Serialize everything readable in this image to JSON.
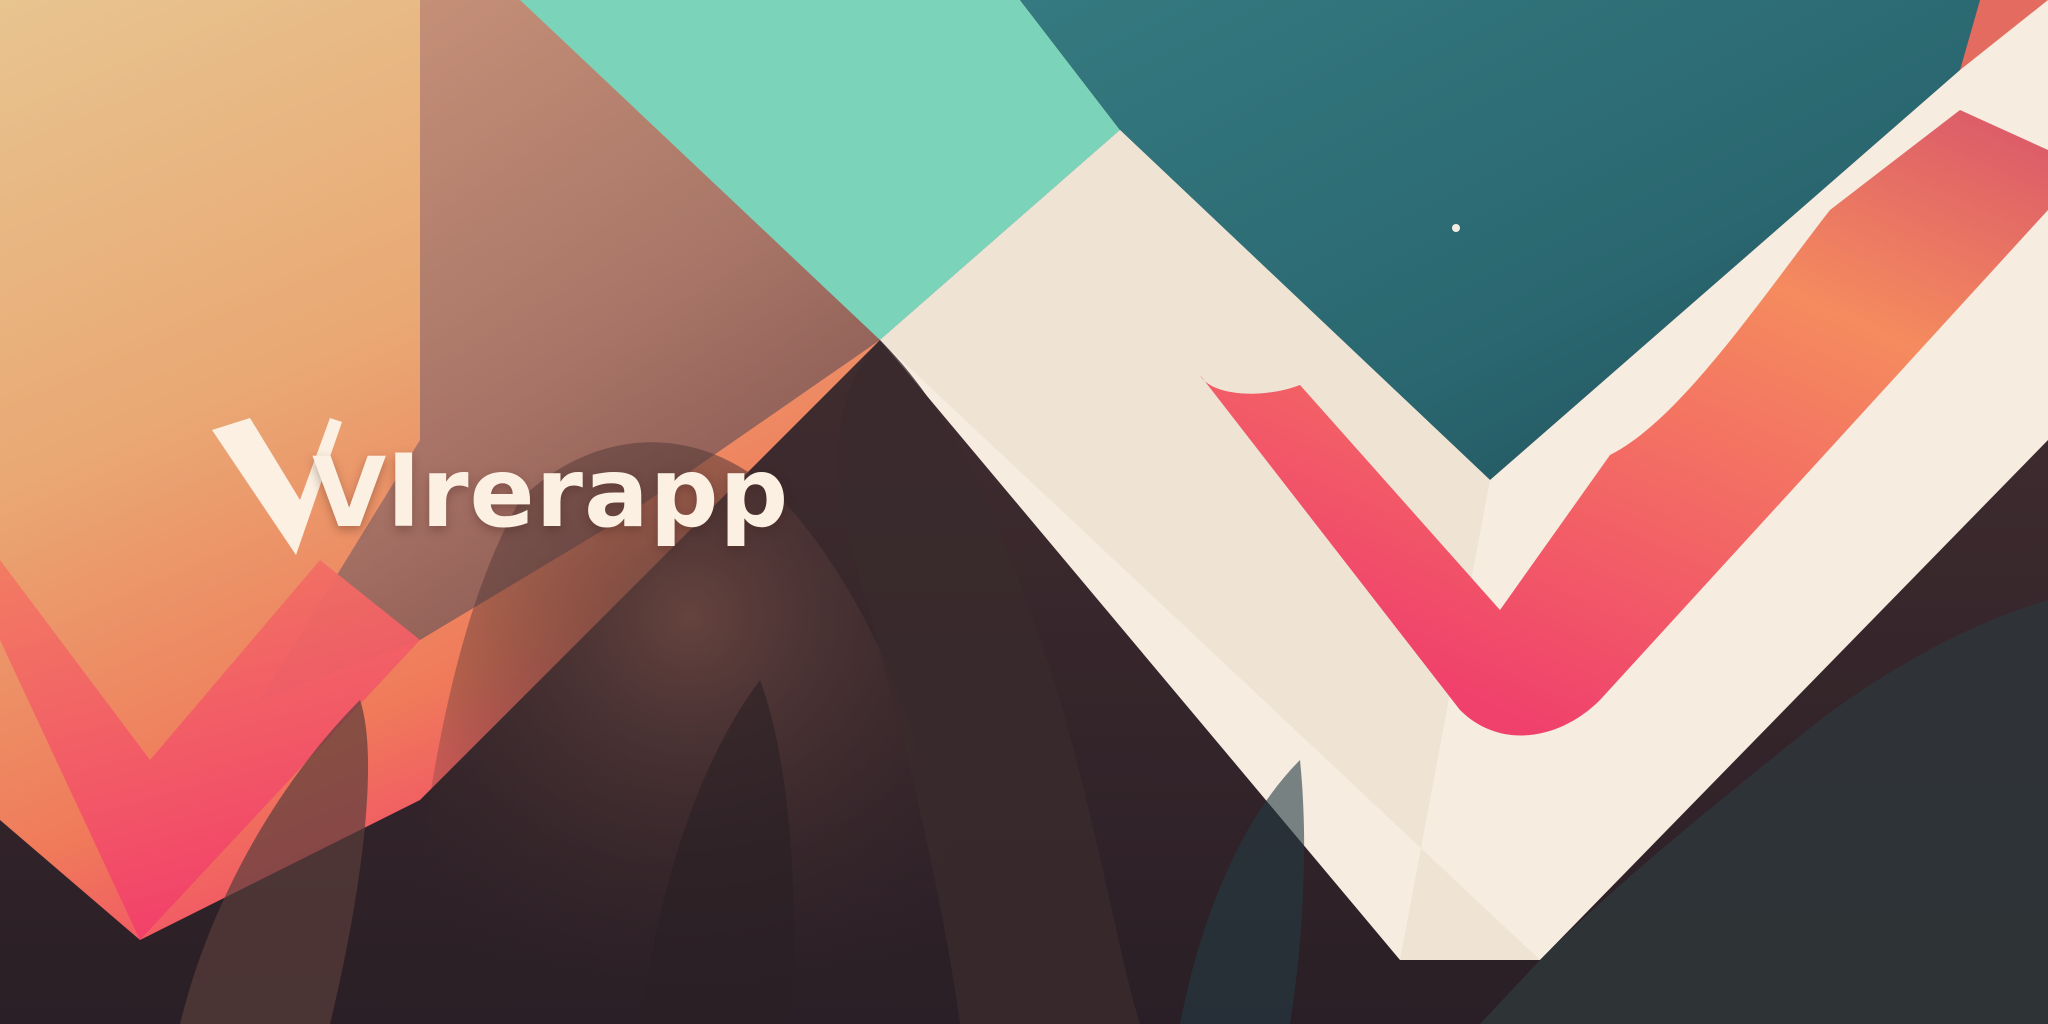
{
  "logo": {
    "text": "Vlrerapp",
    "note_on_text": "",
    "wordmark_color": "#fbf0e2"
  },
  "palette": {
    "peach": "#e8c48f",
    "coral": "#f28a5a",
    "pink": "#f2476a",
    "mauve": "#b98a7b",
    "mint": "#7bd3ba",
    "teal": "#2d6b73",
    "deep_teal": "#1f4a55",
    "cream": "#f6ece0",
    "brown": "#4a3233",
    "dark_brown": "#2f2228"
  },
  "icons": {
    "left_mark": "v-chevron-icon",
    "right_mark": "v-chevron-icon"
  }
}
